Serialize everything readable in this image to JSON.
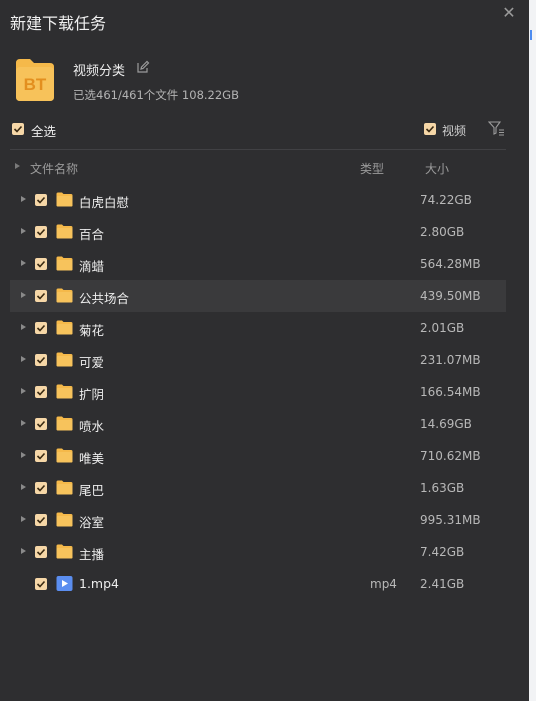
{
  "dialog": {
    "title": "新建下载任务",
    "close_glyph": "✕",
    "task": {
      "icon": "bt-torrent-icon",
      "icon_text": "BT",
      "name": "视频分类",
      "summary": "已选461/461个文件 108.22GB"
    },
    "toolbar": {
      "select_all_label": "全选",
      "select_all_checked": true,
      "video_label": "视频",
      "video_checked": true
    },
    "columns": {
      "name": "文件名称",
      "type": "类型",
      "size": "大小"
    },
    "rows": [
      {
        "kind": "folder",
        "name": "白虎白慰",
        "type": "",
        "size": "74.22GB",
        "checked": true,
        "highlight": false
      },
      {
        "kind": "folder",
        "name": "百合",
        "type": "",
        "size": "2.80GB",
        "checked": true,
        "highlight": false
      },
      {
        "kind": "folder",
        "name": "滴蜡",
        "type": "",
        "size": "564.28MB",
        "checked": true,
        "highlight": false
      },
      {
        "kind": "folder",
        "name": "公共场合",
        "type": "",
        "size": "439.50MB",
        "checked": true,
        "highlight": true
      },
      {
        "kind": "folder",
        "name": "菊花",
        "type": "",
        "size": "2.01GB",
        "checked": true,
        "highlight": false
      },
      {
        "kind": "folder",
        "name": "可爱",
        "type": "",
        "size": "231.07MB",
        "checked": true,
        "highlight": false
      },
      {
        "kind": "folder",
        "name": "扩阴",
        "type": "",
        "size": "166.54MB",
        "checked": true,
        "highlight": false
      },
      {
        "kind": "folder",
        "name": "喷水",
        "type": "",
        "size": "14.69GB",
        "checked": true,
        "highlight": false
      },
      {
        "kind": "folder",
        "name": "唯美",
        "type": "",
        "size": "710.62MB",
        "checked": true,
        "highlight": false
      },
      {
        "kind": "folder",
        "name": "尾巴",
        "type": "",
        "size": "1.63GB",
        "checked": true,
        "highlight": false
      },
      {
        "kind": "folder",
        "name": "浴室",
        "type": "",
        "size": "995.31MB",
        "checked": true,
        "highlight": false
      },
      {
        "kind": "folder",
        "name": "主播",
        "type": "",
        "size": "7.42GB",
        "checked": true,
        "highlight": false
      },
      {
        "kind": "file",
        "name": "1.mp4",
        "type": "mp4",
        "size": "2.41GB",
        "checked": true,
        "highlight": false
      }
    ]
  },
  "colors": {
    "background": "#2e2e30",
    "checkbox": "#f6d7a7",
    "folder": "#f5b94a",
    "video_file": "#5b8ef0",
    "highlight_row": "#3a3a3c"
  }
}
